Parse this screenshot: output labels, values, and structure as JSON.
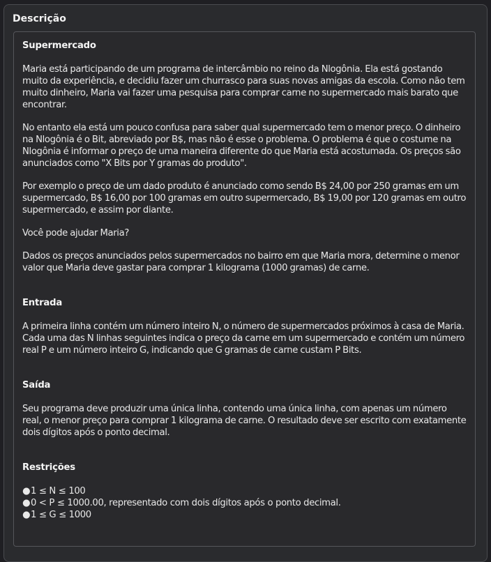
{
  "panel": {
    "heading": "Descrição"
  },
  "sections": {
    "supermercado": {
      "title": "Supermercado",
      "paragraphs": [
        "Maria está participando de um programa de intercâmbio no reino da Nlogônia. Ela está gostando muito da experiência, e decidiu fazer um churrasco para suas novas amigas da escola. Como não tem muito dinheiro, Maria vai fazer uma pesquisa para comprar carne no supermercado mais barato que encontrar.",
        "No entanto ela está um pouco confusa para saber qual supermercado tem o menor preço. O dinheiro na Nlogônia é o Bit, abreviado por B$, mas não é esse o problema. O problema é que o costume na Nlogônia é informar o preço de uma maneira diferente do que Maria está acostumada. Os preços são anunciados como \"X Bits por Y gramas do produto\".",
        "Por exemplo o preço de um dado produto é anunciado como sendo B$ 24,00 por 250 gramas em um supermercado, B$ 16,00 por 100 gramas em outro supermercado, B$ 19,00 por 120 gramas em outro supermercado, e assim por diante.",
        "Você pode ajudar Maria?",
        "Dados os preços anunciados pelos supermercados no bairro em que Maria mora, determine o menor valor que Maria deve gastar para comprar 1 kilograma (1000 gramas) de carne."
      ]
    },
    "entrada": {
      "title": "Entrada",
      "paragraph": "A primeira linha contém um número inteiro N, o número de supermercados próximos à casa de Maria. Cada uma das N linhas seguintes indica o preço da carne em um supermercado e contém um número real P e um número inteiro G, indicando que G gramas de carne custam P Bits."
    },
    "saida": {
      "title": "Saída",
      "paragraph": "Seu programa deve produzir uma única linha, contendo uma única linha, com apenas um número real, o menor preço para comprar 1 kilograma de carne. O resultado deve ser escrito com exatamente dois dígitos após o ponto decimal."
    },
    "restricoes": {
      "title": "Restrições",
      "bullet": "●",
      "items": [
        "1 ≤ N ≤ 100",
        "0 < P ≤ 1000.00, representado com dois dígitos após o ponto decimal.",
        "1 ≤ G ≤ 1000"
      ]
    }
  }
}
